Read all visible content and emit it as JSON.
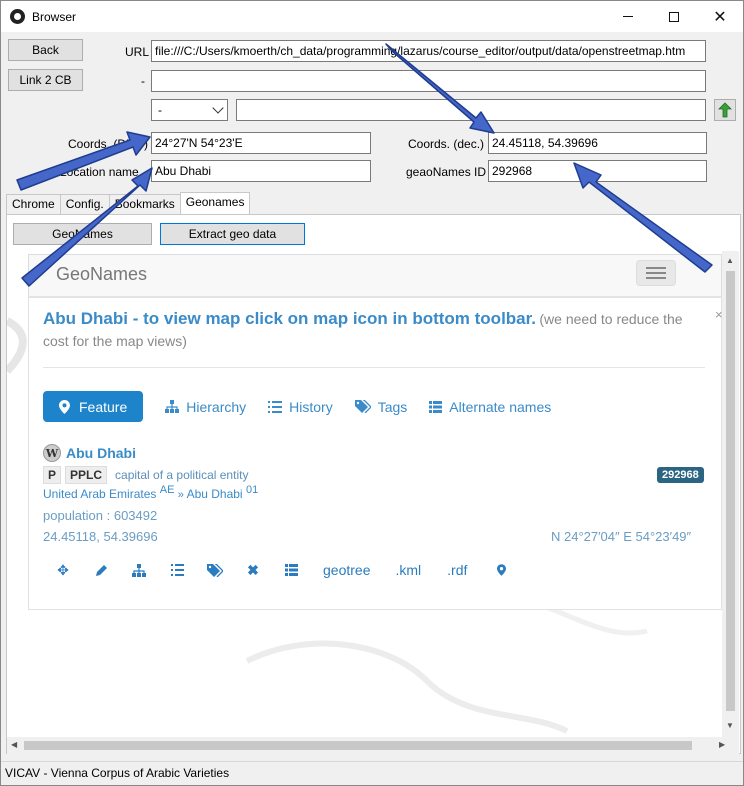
{
  "window": {
    "title": "Browser"
  },
  "toolbar": {
    "back_label": "Back",
    "link2cb_label": "Link 2 CB",
    "url_label": "URL",
    "url_value": "file:///C:/Users/kmoerth/ch_data/programming/lazarus/course_editor/output/data/openstreetmap.htm",
    "second_label": "-",
    "second_value": "",
    "select_value": "-",
    "third_value": ""
  },
  "coords": {
    "dms_label": "Coords. (DMS)",
    "dms_value": "24°27'N 54°23'E",
    "dec_label": "Coords. (dec.)",
    "dec_value": "24.45118, 54.39696",
    "location_label": "Location name",
    "location_value": "Abu Dhabi",
    "geonames_label": "geaoNames ID",
    "geonames_value": "292968"
  },
  "tabs": [
    "Chrome",
    "Config.",
    "Bookmarks",
    "Geonames"
  ],
  "active_tab": "Geonames",
  "panel_buttons": {
    "geonames": "GeoNames",
    "extract": "Extract geo data"
  },
  "geonames_page": {
    "brand": "GeoNames",
    "title_main": "Abu Dhabi - to view map click on map icon in bottom toolbar.",
    "title_note": "(we need to reduce the cost for the map views)",
    "close": "×",
    "nav": [
      "Feature",
      "Hierarchy",
      "History",
      "Tags",
      "Alternate names"
    ],
    "place_name": "Abu Dhabi",
    "feature_class": "P",
    "feature_code": "PPLC",
    "feature_desc": "capital of a political entity",
    "id_badge": "292968",
    "country": "United Arab Emirates",
    "country_code": "AE",
    "admin1": "Abu Dhabi",
    "admin1_code": "01",
    "population": "population : 603492",
    "coords_dec": "24.45118, 54.39696",
    "coords_dms": "N 24°27′04″ E 54°23′49″",
    "tool_links": [
      "geotree",
      ".kml",
      ".rdf"
    ]
  },
  "status": {
    "text": "VICAV - Vienna Corpus of Arabic Varieties"
  },
  "colors": {
    "link": "#3a8bc9",
    "pill": "#1d83ca",
    "badge": "#2c6584",
    "arrow": "#3f63c8"
  }
}
